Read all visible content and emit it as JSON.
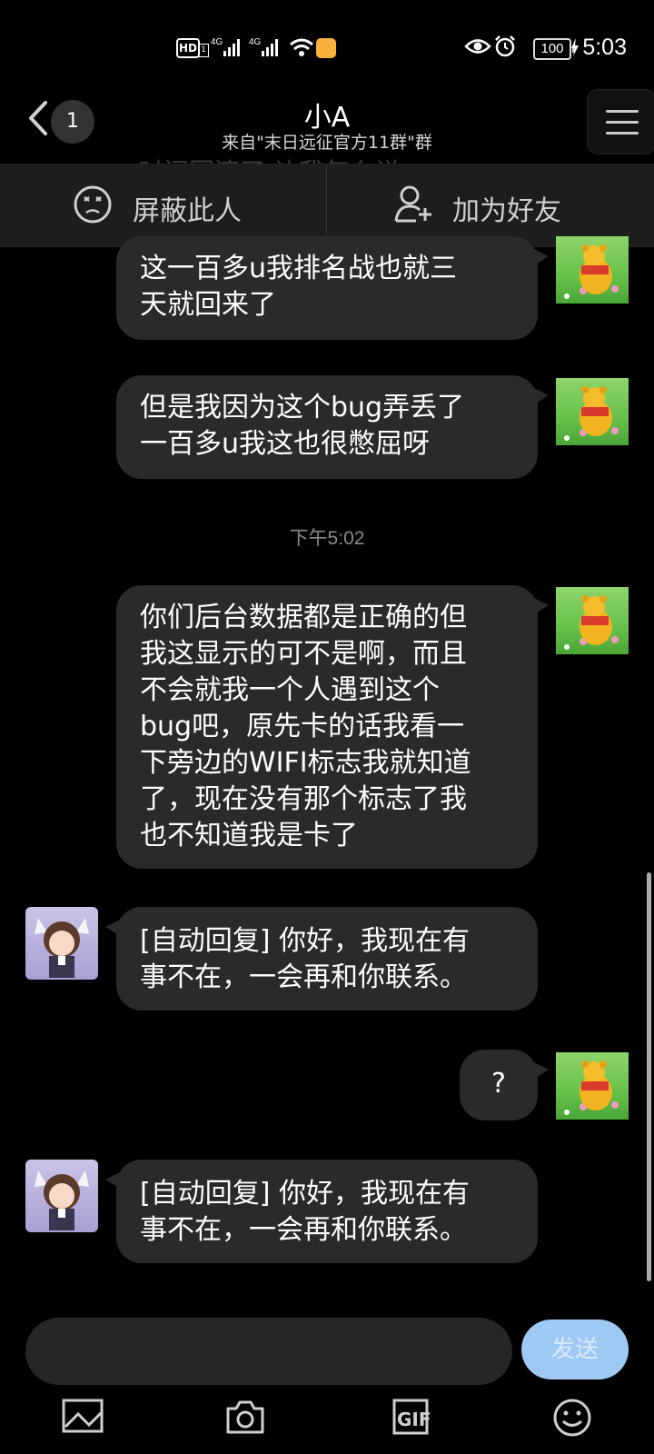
{
  "status_bar": {
    "time": "5:03",
    "battery": "100",
    "hd_label": "HD",
    "sim_label": "1",
    "network_label_1": "4G",
    "network_label_2": "4G"
  },
  "header": {
    "unread_count": "1",
    "title": "小A",
    "subtitle": "来自\"末日远征官方11群\"群",
    "ghost_text": "时间回滚了 让我怎么说"
  },
  "action_bar": {
    "block_label": "屏蔽此人",
    "add_friend_label": "加为好友"
  },
  "messages": [
    {
      "side": "out",
      "lines": [
        "这一百多u我排名战也就三",
        "天就回来了"
      ]
    },
    {
      "side": "out",
      "lines": [
        "但是我因为这个bug弄丢了",
        "一百多u我这也很憋屈呀"
      ]
    },
    {
      "side": "out",
      "lines": [
        "你们后台数据都是正确的但",
        "我这显示的可不是啊，而且",
        "不会就我一个人遇到这个",
        "bug吧，原先卡的话我看一",
        "下旁边的WIFI标志我就知道",
        "了，现在没有那个标志了我",
        "也不知道我是卡了"
      ]
    },
    {
      "side": "in",
      "lines": [
        "[自动回复] 你好，我现在有",
        "事不在，一会再和你联系。"
      ]
    },
    {
      "side": "out",
      "lines": [
        "?"
      ]
    },
    {
      "side": "in",
      "lines": [
        "[自动回复] 你好，我现在有",
        "事不在，一会再和你联系。"
      ]
    }
  ],
  "timestamp": "下午5:02",
  "input": {
    "value": "",
    "placeholder": "",
    "send_label": "发送"
  },
  "toolbar": {
    "gif_label": "GIF"
  },
  "colors": {
    "background": "#000000",
    "bubble": "#2a2a2a",
    "send_button": "#9ec9f4",
    "timestamp": "#8a8a8a"
  }
}
